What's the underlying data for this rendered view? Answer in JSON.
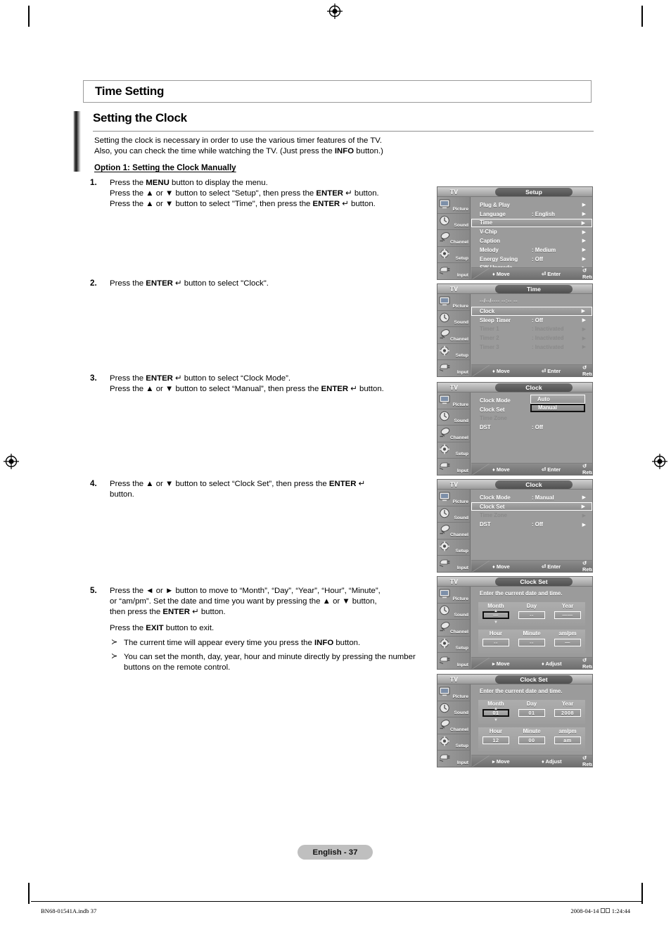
{
  "page": {
    "title_bar": "Time Setting",
    "section_title": "Setting the Clock",
    "intro_line1": "Setting the clock is necessary in order to use the various timer features of the TV.",
    "intro_line2_a": "Also, you can check the time while watching the TV. (Just press the ",
    "intro_line2_b": "INFO",
    "intro_line2_c": " button.)",
    "option_heading": "Option 1: Setting the Clock Manually",
    "page_badge": "English - 37",
    "footer_left": "BN68-01541A.indb  37",
    "footer_date": "2008-04-14",
    "footer_time": "1:24:44"
  },
  "steps": [
    {
      "num": "1.",
      "lines": [
        [
          {
            "t": "Press the "
          },
          {
            "t": "MENU",
            "b": true
          },
          {
            "t": " button to display the menu."
          }
        ],
        [
          {
            "t": "Press the ▲ or ▼ button to select \"Setup\", then press the "
          },
          {
            "t": "ENTER",
            "b": true
          },
          {
            "t": " ↵ button."
          }
        ],
        [
          {
            "t": "Press the ▲ or ▼ button to select \"Time\", then press the "
          },
          {
            "t": "ENTER",
            "b": true
          },
          {
            "t": " ↵ button."
          }
        ]
      ]
    },
    {
      "num": "2.",
      "lines": [
        [
          {
            "t": "Press the "
          },
          {
            "t": "ENTER",
            "b": true
          },
          {
            "t": " ↵ button to select \"Clock\"."
          }
        ]
      ]
    },
    {
      "num": "3.",
      "lines": [
        [
          {
            "t": "Press the "
          },
          {
            "t": "ENTER",
            "b": true
          },
          {
            "t": " ↵ button to select “Clock Mode”."
          }
        ],
        [
          {
            "t": "Press the ▲ or ▼ button to select “Manual”, then press the "
          },
          {
            "t": "ENTER",
            "b": true
          },
          {
            "t": " ↵ button."
          }
        ]
      ]
    },
    {
      "num": "4.",
      "lines": [
        [
          {
            "t": "Press the ▲ or ▼ button to select “Clock Set”, then press the "
          },
          {
            "t": "ENTER",
            "b": true
          },
          {
            "t": " ↵"
          }
        ],
        [
          {
            "t": "button."
          }
        ]
      ]
    },
    {
      "num": "5.",
      "lines": [
        [
          {
            "t": "Press the ◄ or ► button to move to “Month”, “Day”, “Year”, “Hour”, “Minute”,"
          }
        ],
        [
          {
            "t": "or “am/pm”. Set the date and time you want by pressing the ▲ or ▼ button,"
          }
        ],
        [
          {
            "t": "then press the "
          },
          {
            "t": "ENTER",
            "b": true
          },
          {
            "t": " ↵ button."
          }
        ]
      ],
      "extra": [
        {
          "t": "Press the "
        },
        {
          "t": "EXIT",
          "b": true
        },
        {
          "t": " button to exit."
        }
      ],
      "notes": [
        [
          {
            "t": "The current time will appear every time you press the "
          },
          {
            "t": "INFO",
            "b": true
          },
          {
            "t": " button."
          }
        ],
        [
          {
            "t": "You can set the month, day, year, hour and minute directly by pressing the number buttons on the remote control."
          }
        ]
      ]
    }
  ],
  "osd_common": {
    "tv_label": "TV",
    "sidebar": [
      {
        "label": "Picture",
        "icon": "picture-icon"
      },
      {
        "label": "Sound",
        "icon": "sound-icon"
      },
      {
        "label": "Channel",
        "icon": "channel-icon"
      },
      {
        "label": "Setup",
        "icon": "setup-gear-icon"
      },
      {
        "label": "Input",
        "icon": "input-plug-icon"
      }
    ],
    "hint_move": "Move",
    "hint_enter": "Enter",
    "hint_return": "Return",
    "hint_adjust": "Adjust"
  },
  "osd_panels": [
    {
      "id": "setup-menu",
      "title": "Setup",
      "rows": [
        {
          "label": "Plug & Play",
          "value": "",
          "caret": true,
          "state": "normal"
        },
        {
          "label": "Language",
          "value": ": English",
          "caret": true,
          "state": "normal"
        },
        {
          "label": "Time",
          "value": "",
          "caret": true,
          "state": "selected"
        },
        {
          "label": "V-Chip",
          "value": "",
          "caret": true,
          "state": "normal"
        },
        {
          "label": "Caption",
          "value": "",
          "caret": true,
          "state": "normal"
        },
        {
          "label": "Melody",
          "value": ": Medium",
          "caret": true,
          "state": "normal"
        },
        {
          "label": "Energy Saving",
          "value": ": Off",
          "caret": true,
          "state": "normal"
        },
        {
          "label": "SW Upgrade",
          "value": "",
          "caret": true,
          "state": "normal"
        }
      ],
      "hints": [
        "Move",
        "Enter",
        "Return"
      ]
    },
    {
      "id": "time-menu",
      "title": "Time",
      "dashline": "--/--/---- --:-- --",
      "rows": [
        {
          "label": "Clock",
          "value": "",
          "caret": true,
          "state": "selected"
        },
        {
          "label": "Sleep Timer",
          "value": ": Off",
          "caret": true,
          "state": "normal"
        },
        {
          "label": "Timer 1",
          "value": ": Inactivated",
          "caret": true,
          "state": "dim"
        },
        {
          "label": "Timer 2",
          "value": ": Inactivated",
          "caret": true,
          "state": "dim"
        },
        {
          "label": "Timer 3",
          "value": ": Inactivated",
          "caret": true,
          "state": "dim"
        }
      ],
      "hints": [
        "Move",
        "Enter",
        "Return"
      ]
    },
    {
      "id": "clock-mode-menu",
      "title": "Clock",
      "rows": [
        {
          "label": "Clock Mode",
          "value": ":",
          "caret": false,
          "state": "normal"
        },
        {
          "label": "Clock Set",
          "value": "",
          "caret": false,
          "state": "normal"
        },
        {
          "label": "Time Zone",
          "value": "",
          "caret": false,
          "state": "dim"
        },
        {
          "label": "DST",
          "value": ": Off",
          "caret": false,
          "state": "normal"
        }
      ],
      "dropdown": {
        "option_a": "Auto",
        "option_b": "Manual"
      },
      "hints": [
        "Move",
        "Enter",
        "Return"
      ]
    },
    {
      "id": "clock-set-select-menu",
      "title": "Clock",
      "rows": [
        {
          "label": "Clock Mode",
          "value": ": Manual",
          "caret": true,
          "state": "normal"
        },
        {
          "label": "Clock Set",
          "value": "",
          "caret": true,
          "state": "selected"
        },
        {
          "label": "Time Zone",
          "value": "",
          "caret": true,
          "state": "dim"
        },
        {
          "label": "DST",
          "value": ": Off",
          "caret": true,
          "state": "normal"
        }
      ],
      "hints": [
        "Move",
        "Enter",
        "Return"
      ]
    },
    {
      "id": "clock-set-empty",
      "title": "Clock Set",
      "note": "Enter the current date and time.",
      "fields_row1": [
        {
          "header": "Month",
          "value": "—",
          "active": true
        },
        {
          "header": "Day",
          "value": "--",
          "active": false
        },
        {
          "header": "Year",
          "value": "——",
          "active": false
        }
      ],
      "fields_row2": [
        {
          "header": "Hour",
          "value": "--",
          "active": false
        },
        {
          "header": "Minute",
          "value": "--",
          "active": false
        },
        {
          "header": "am/pm",
          "value": "—",
          "active": false
        }
      ],
      "hints": [
        "Move",
        "Adjust",
        "Return"
      ]
    },
    {
      "id": "clock-set-filled",
      "title": "Clock Set",
      "note": "Enter the current date and time.",
      "fields_row1": [
        {
          "header": "Month",
          "value": "01",
          "active": true
        },
        {
          "header": "Day",
          "value": "01",
          "active": false
        },
        {
          "header": "Year",
          "value": "2008",
          "active": false
        }
      ],
      "fields_row2": [
        {
          "header": "Hour",
          "value": "12",
          "active": false
        },
        {
          "header": "Minute",
          "value": "00",
          "active": false
        },
        {
          "header": "am/pm",
          "value": "am",
          "active": false
        }
      ],
      "hints": [
        "Move",
        "Adjust",
        "Return"
      ]
    }
  ]
}
